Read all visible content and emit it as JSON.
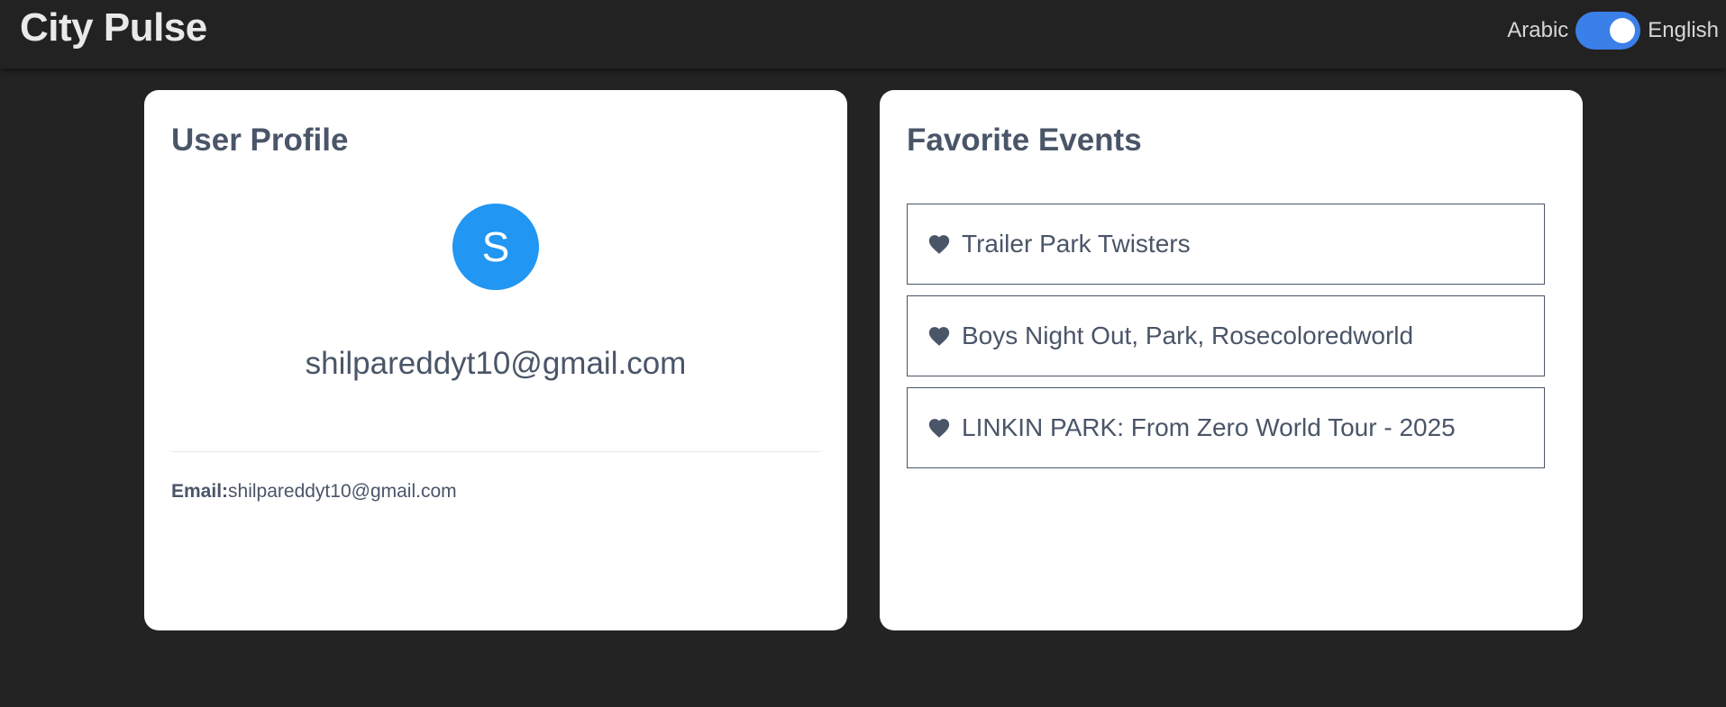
{
  "app": {
    "title": "City Pulse"
  },
  "language_toggle": {
    "left_label": "Arabic",
    "right_label": "English",
    "selected": "English",
    "accent_color": "#3b7fe8"
  },
  "profile": {
    "heading": "User Profile",
    "avatar_initial": "S",
    "avatar_color": "#2196f3",
    "display_email": "shilpareddyt10@gmail.com",
    "email_label": "Email:",
    "email_value": "shilpareddyt10@gmail.com"
  },
  "favorites": {
    "heading": "Favorite Events",
    "icon": "heart-icon",
    "items": [
      {
        "title": "Trailer Park Twisters"
      },
      {
        "title": "Boys Night Out, Park, Rosecoloredworld"
      },
      {
        "title": "LINKIN PARK: From Zero World Tour - 2025"
      }
    ]
  }
}
